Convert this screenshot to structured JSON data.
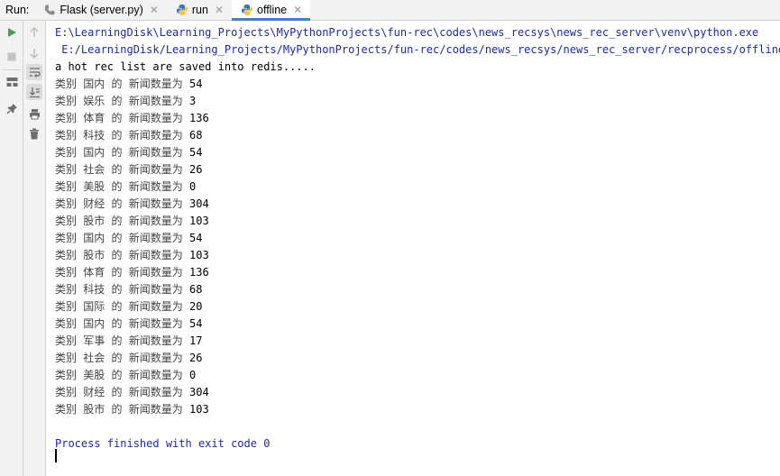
{
  "run_label": "Run:",
  "tabs": [
    {
      "label": "Flask (server.py)",
      "icon": "phone-icon"
    },
    {
      "label": "run",
      "icon": "python-icon"
    },
    {
      "label": "offline",
      "icon": "python-icon",
      "active": true
    }
  ],
  "console": {
    "cmd_line_1": "E:\\LearningDisk\\Learning_Projects\\MyPythonProjects\\fun-rec\\codes\\news_recsys\\news_rec_server\\venv\\python.exe",
    "cmd_line_2": " E:/LearningDisk/Learning_Projects/MyPythonProjects/fun-rec/codes/news_recsys/news_rec_server/recprocess/offline.py",
    "info_line": "a hot rec list are saved into redis.....",
    "category_prefix": "类别",
    "category_mid": "的",
    "category_suffix": "新闻数量为",
    "rows": [
      {
        "category": "国内",
        "count": "54"
      },
      {
        "category": "娱乐",
        "count": "3"
      },
      {
        "category": "体育",
        "count": "136"
      },
      {
        "category": "科技",
        "count": "68"
      },
      {
        "category": "国内",
        "count": "54"
      },
      {
        "category": "社会",
        "count": "26"
      },
      {
        "category": "美股",
        "count": "0"
      },
      {
        "category": "财经",
        "count": "304"
      },
      {
        "category": "股市",
        "count": "103"
      },
      {
        "category": "国内",
        "count": "54"
      },
      {
        "category": "股市",
        "count": "103"
      },
      {
        "category": "体育",
        "count": "136"
      },
      {
        "category": "科技",
        "count": "68"
      },
      {
        "category": "国际",
        "count": "20"
      },
      {
        "category": "国内",
        "count": "54"
      },
      {
        "category": "军事",
        "count": "17"
      },
      {
        "category": "社会",
        "count": "26"
      },
      {
        "category": "美股",
        "count": "0"
      },
      {
        "category": "财经",
        "count": "304"
      },
      {
        "category": "股市",
        "count": "103"
      }
    ],
    "exit_line": "Process finished with exit code 0"
  },
  "colors": {
    "path_blue": "#1c2aa6",
    "tab_accent": "#4083c9",
    "run_green": "#499c54"
  }
}
